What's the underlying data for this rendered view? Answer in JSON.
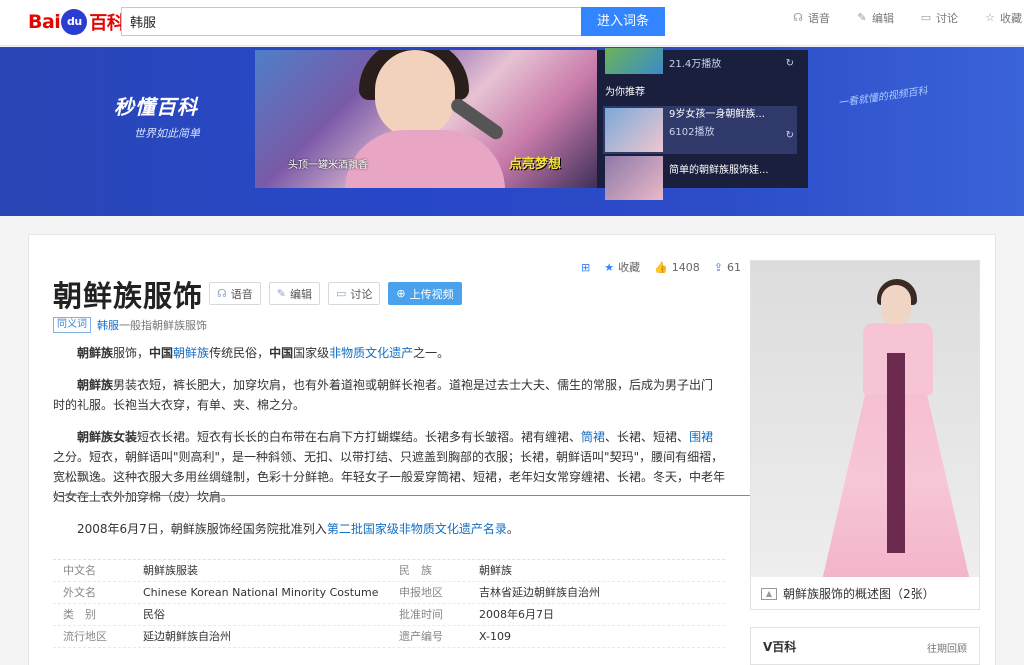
{
  "header": {
    "logo_bai": "Bai",
    "logo_du": "du",
    "logo_baike": "百科",
    "search_value": "韩服",
    "search_button": "进入词条",
    "actions": [
      {
        "label": "语音",
        "icon": "headphones-icon"
      },
      {
        "label": "编辑",
        "icon": "pencil-icon"
      },
      {
        "label": "讨论",
        "icon": "chat-icon"
      },
      {
        "label": "收藏",
        "icon": "star-icon"
      }
    ]
  },
  "banner": {
    "brand": "秒懂百科",
    "subtitle": "世界如此简单",
    "slogan": "一看就懂的视频百科",
    "video_caption": "头顶一罐米酒飘香",
    "video_overlay": "点亮梦想",
    "side": {
      "top_views": "21.4万播放",
      "section": "为你推荐",
      "items": [
        {
          "title": "9岁女孩一身朝鲜族...",
          "views": "6102播放"
        },
        {
          "title": "简单的朝鲜族服饰娃..."
        }
      ]
    }
  },
  "article": {
    "title": "朝鲜族服饰",
    "buttons": [
      {
        "label": "语音",
        "icon": "headphones-icon"
      },
      {
        "label": "编辑",
        "icon": "pencil-icon"
      },
      {
        "label": "讨论",
        "icon": "chat-icon"
      },
      {
        "label": "上传视频",
        "icon": "plus-circle-icon"
      }
    ],
    "stats": {
      "collect": "收藏",
      "likes": "1408",
      "shares": "61"
    },
    "polysemy_tag": "同义词",
    "polysemy_link": "韩服",
    "polysemy_text": "一般指朝鲜族服饰",
    "p1": {
      "a": "朝鲜族",
      "b": "服饰，",
      "c": "中国",
      "d": "朝鲜族",
      "e": "传统民俗，",
      "f": "中国",
      "g": "国家级",
      "h": "非物质文化遗产",
      "i": "之一。"
    },
    "p2": {
      "a": "朝鲜族",
      "b": "男装衣短，裤长肥大，加穿坎肩，也有外着道袍或朝鲜长袍者。道袍是过去士大夫、儒生的常服，后成为男子出门时的礼服。长袍当大衣穿，有单、夹、棉之分。"
    },
    "p3": {
      "a": "朝鲜族女装",
      "b": "短衣长裙。短衣有长长的白布带在右肩下方打蝴蝶结。长裙多有长皱褶。裙有缠裙、",
      "c": "筒裙",
      "d": "、长裙、短裙、",
      "e": "围裙",
      "f": "之分。短衣，朝鲜语叫\"则高利\"，是一种斜领、无扣、以带打结、只遮盖到胸部的衣服；长裙，朝鲜语叫\"契玛\"，腰间有细褶，宽松飘逸。这种衣服大多用丝绸缝制，色彩十分鲜艳。年轻女子一般爱穿筒裙、短裙，老年妇女常穿缠裙、长裙。冬天，中老年妇女在上衣外加穿棉（皮）坎肩。"
    },
    "p4": {
      "a": "2008年6月7日，朝鲜族服饰经国务院批准列入",
      "b": "第二批国家级非物质文化遗产名录",
      "c": "。"
    },
    "info": [
      {
        "k": "中文名",
        "v": "朝鲜族服装",
        "k2": "民　族",
        "v2": "朝鲜族"
      },
      {
        "k": "外文名",
        "v": "Chinese Korean National Minority Costume",
        "k2": "申报地区",
        "v2": "吉林省延边朝鲜族自治州"
      },
      {
        "k": "类　别",
        "v": "民俗",
        "k2": "批准时间",
        "v2": "2008年6月7日"
      },
      {
        "k": "流行地区",
        "v": "延边朝鲜族自治州",
        "k2": "遗产编号",
        "v2": "X-109"
      }
    ],
    "image_caption": "朝鲜族服饰的概述图（2张）",
    "vbaike": "V百科",
    "vbaike_more": "往期回顾"
  }
}
